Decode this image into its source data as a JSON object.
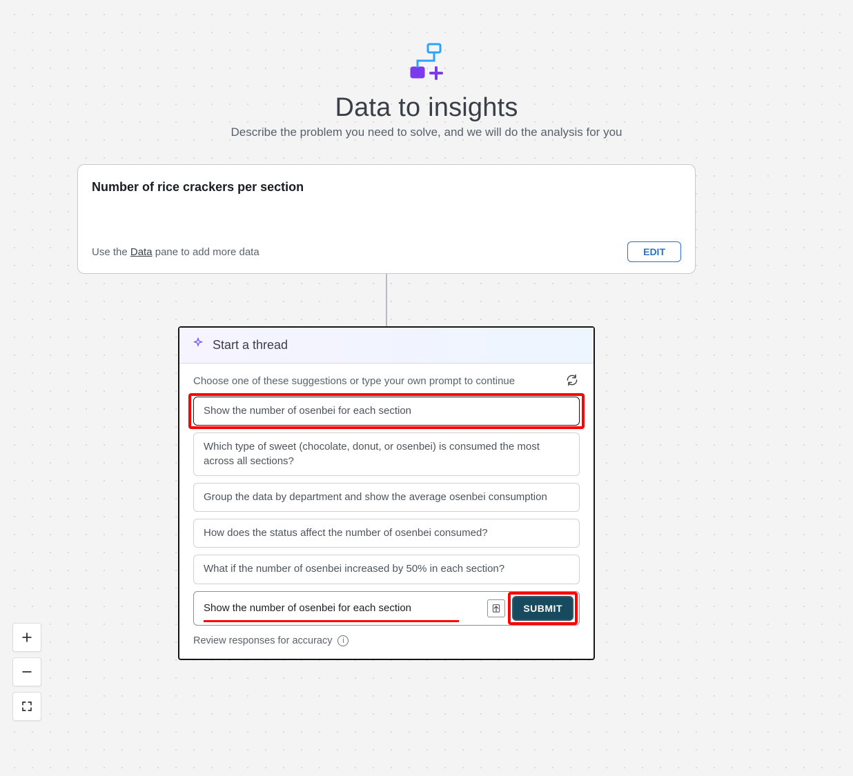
{
  "hero": {
    "title": "Data to insights",
    "subtitle": "Describe the problem you need to solve, and we will do the analysis for you"
  },
  "summary_card": {
    "summary": "Number of rice crackers per section",
    "hint_pre": "Use the ",
    "hint_link": "Data",
    "hint_post": " pane to add more data",
    "edit_label": "EDIT"
  },
  "thread": {
    "title": "Start a thread",
    "prompt": "Choose one of these suggestions or type your own prompt to continue",
    "suggestions": [
      "Show the number of osenbei for each section",
      "Which type of sweet (chocolate, donut, or osenbei) is consumed the most across all sections?",
      "Group the data by department and show the average osenbei consumption",
      "How does the status affect the number of osenbei consumed?",
      "What if the number of osenbei increased by 50% in each section?"
    ],
    "input_value": "Show the number of osenbei for each section",
    "submit_label": "SUBMIT",
    "footer": "Review responses for accuracy"
  }
}
